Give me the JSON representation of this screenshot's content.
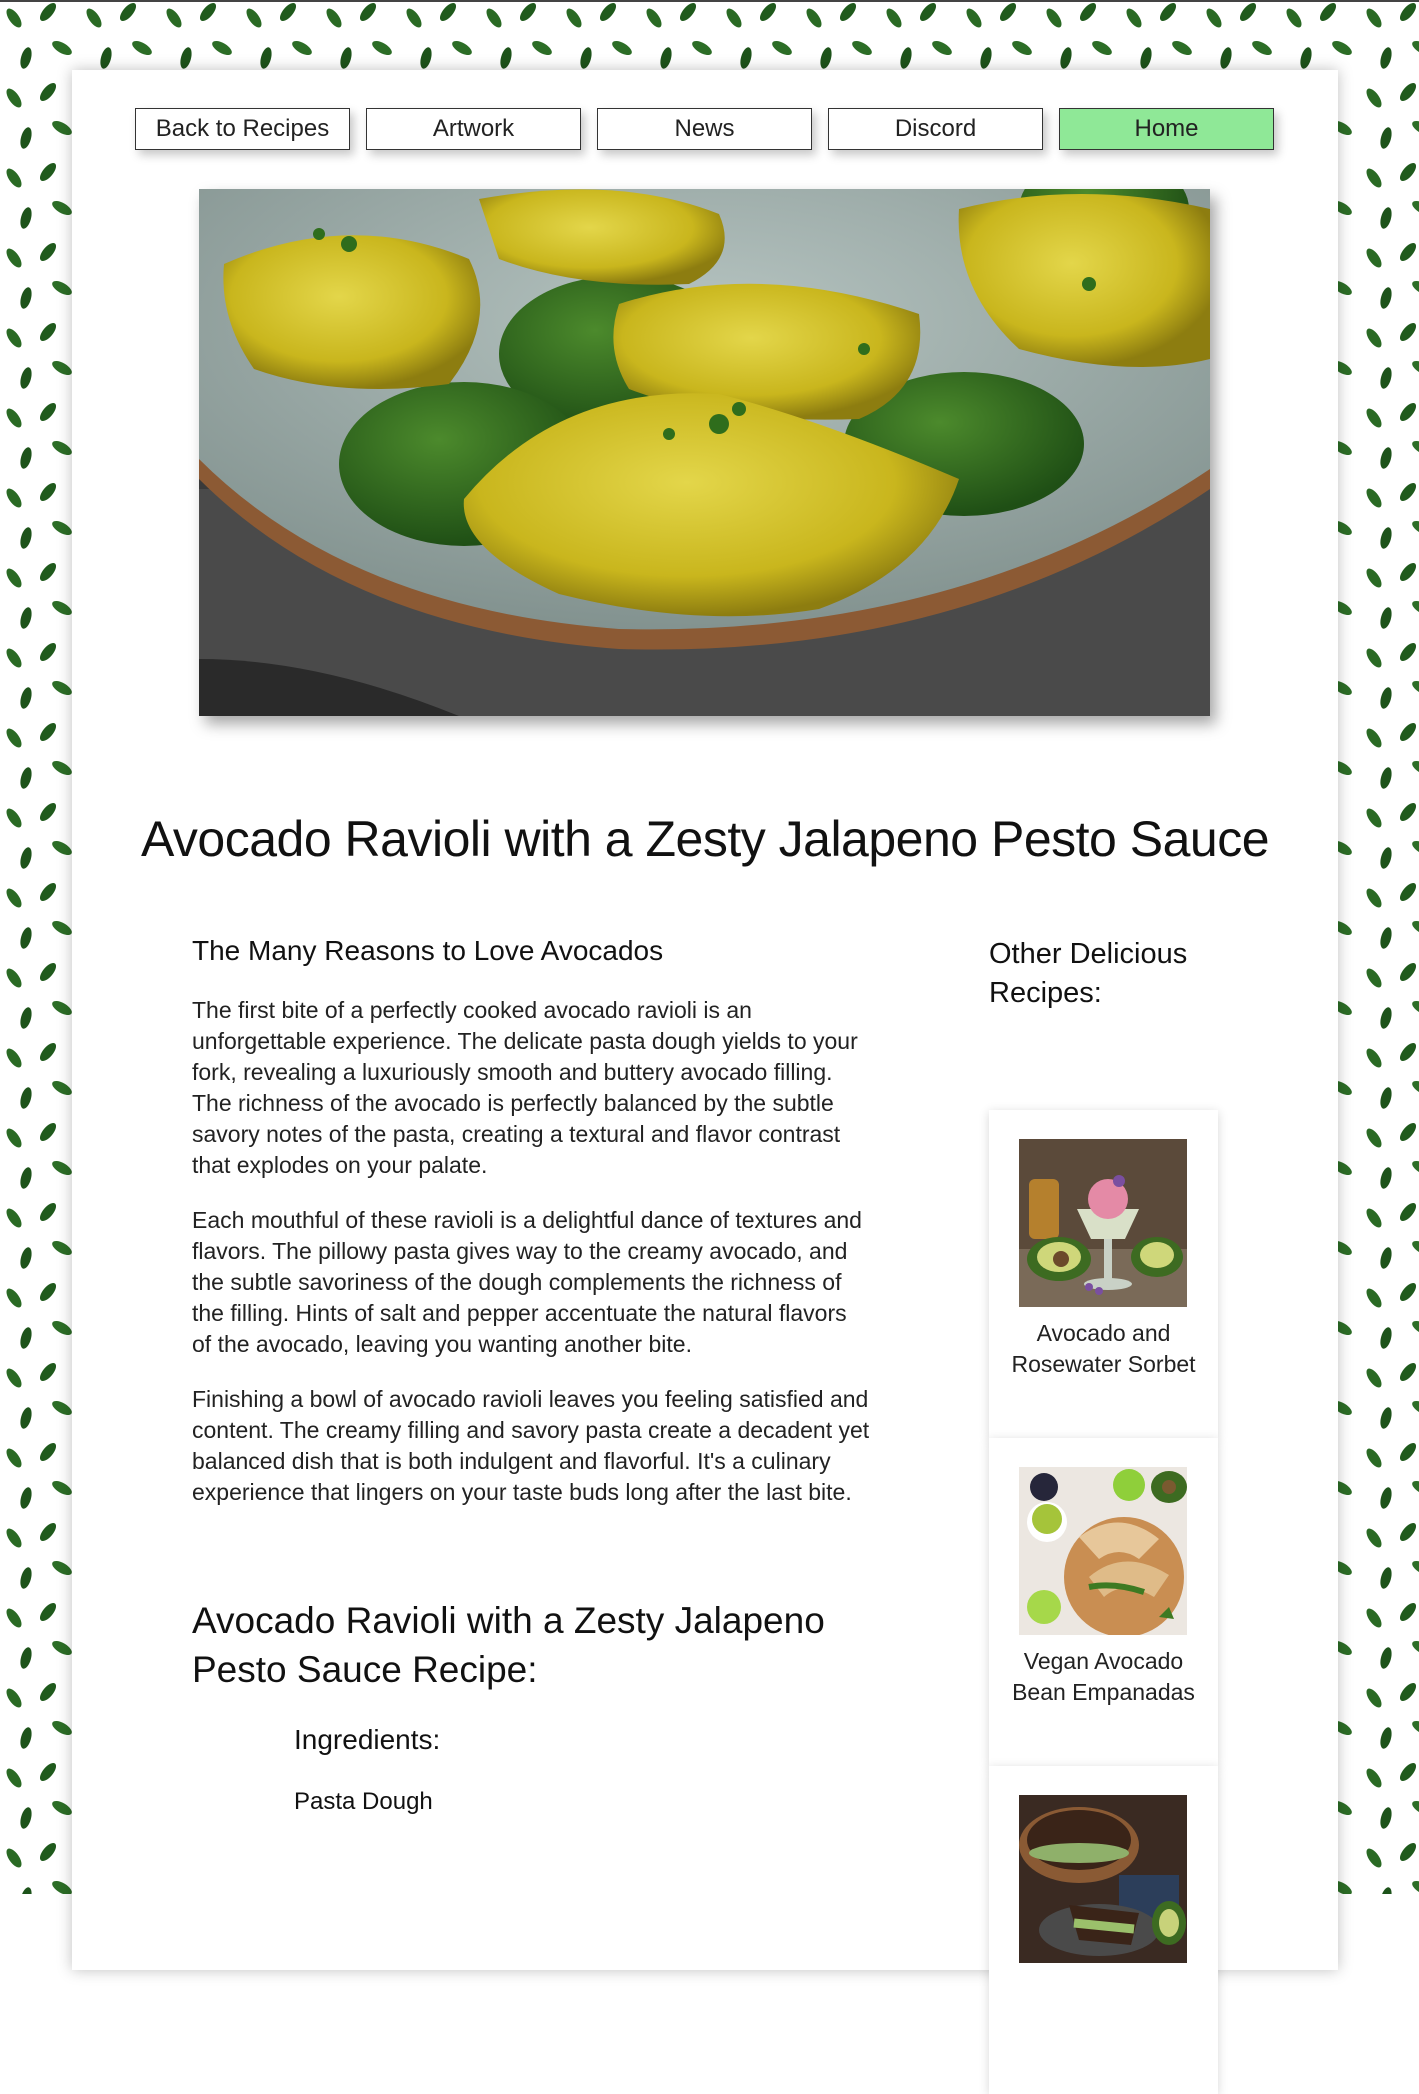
{
  "nav": {
    "items": [
      {
        "label": "Back to Recipes",
        "active": false
      },
      {
        "label": "Artwork",
        "active": false
      },
      {
        "label": "News",
        "active": false
      },
      {
        "label": "Discord",
        "active": false
      },
      {
        "label": "Home",
        "active": true
      }
    ]
  },
  "hero": {
    "image": "avocado-ravioli-photo"
  },
  "title": "Avocado Ravioli with a Zesty Jalapeno Pesto Sauce",
  "article": {
    "heading": "The Many Reasons to Love Avocados",
    "paragraphs": [
      "The first bite of a perfectly cooked avocado ravioli is an unforgettable experience. The delicate pasta dough yields to your fork, revealing a luxuriously smooth and buttery avocado filling. The richness of the avocado is perfectly balanced by the subtle savory notes of the pasta, creating a textural and flavor contrast that explodes on your palate.",
      "Each mouthful of these ravioli is a delightful dance of textures and flavors. The pillowy pasta gives way to the creamy avocado, and the subtle savoriness of the dough complements the richness of the filling. Hints of salt and pepper accentuate the natural flavors of the avocado, leaving you wanting another bite.",
      "Finishing a bowl of avocado ravioli leaves you feeling satisfied and content. The creamy filling and savory pasta create a decadent yet balanced dish that is both indulgent and flavorful. It's a culinary experience that lingers on your taste buds long after the last bite."
    ],
    "recipe_heading": "Avocado Ravioli with a Zesty Jalapeno Pesto Sauce Recipe:",
    "ingredients_heading": "Ingredients:",
    "subsection_heading": "Pasta Dough"
  },
  "sidebar": {
    "title": "Other Delicious Recipes:",
    "cards": [
      {
        "label": "Avocado and Rosewater Sorbet",
        "image": "sorbet-photo"
      },
      {
        "label": "Vegan Avocado Bean Empanadas",
        "image": "empanadas-photo"
      },
      {
        "label": "",
        "image": "avocado-pie-photo"
      }
    ]
  },
  "colors": {
    "accent_active": "#8fe897",
    "pattern_leaf": "#1f5a1c",
    "background": "#ffffff"
  }
}
